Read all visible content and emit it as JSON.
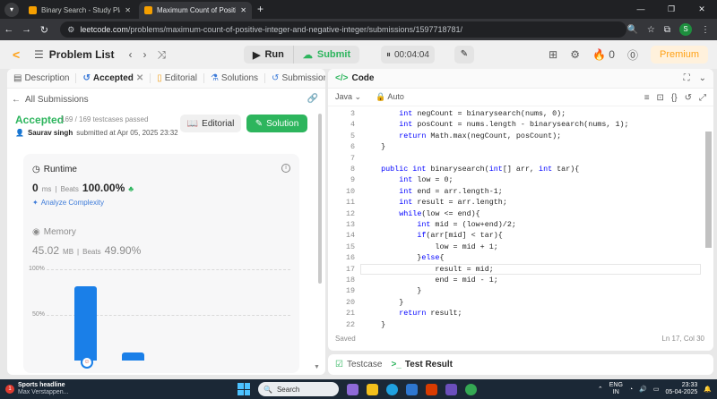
{
  "browser": {
    "tabs": [
      {
        "title": "Binary Search - Study Plan - Le"
      },
      {
        "title": "Maximum Count of Positive Inte"
      }
    ],
    "new_tab": "+",
    "url_host": "leetcode.com",
    "url_path": "/problems/maximum-count-of-positive-integer-and-negative-integer/submissions/1597718781/",
    "profile_initial": "S"
  },
  "topbar": {
    "problem_list": "Problem List",
    "run": "Run",
    "submit": "Submit",
    "timer": "00:04:04",
    "streak": "0",
    "premium": "Premium"
  },
  "left": {
    "tabs": [
      {
        "label": "Description",
        "icon": "description-icon"
      },
      {
        "label": "Accepted",
        "icon": "history-icon"
      },
      {
        "label": "Editorial",
        "icon": "book-icon"
      },
      {
        "label": "Solutions",
        "icon": "flask-icon"
      },
      {
        "label": "Submissions",
        "icon": "history-icon"
      }
    ],
    "all_submissions": "All Submissions",
    "status": "Accepted",
    "testcases": "169 / 169 testcases passed",
    "user": "Saurav singh",
    "submitted": "submitted at Apr 05, 2025 23:32",
    "editorial_btn": "Editorial",
    "solution_btn": "Solution",
    "runtime": {
      "label": "Runtime",
      "value": "0",
      "unit": "ms",
      "beats_label": "Beats",
      "beats": "100.00%",
      "analyze": "Analyze Complexity"
    },
    "memory": {
      "label": "Memory",
      "value": "45.02",
      "unit": "MB",
      "beats_label": "Beats",
      "beats": "49.90%"
    },
    "chart_data": {
      "type": "bar",
      "yticks": [
        "100%",
        "50%"
      ],
      "values": [
        0.81,
        0.09
      ]
    }
  },
  "code": {
    "title": "Code",
    "language": "Java",
    "auto": "Auto",
    "lines": [
      {
        "n": "3",
        "t": "        int negCount = binarysearch(nums, 0);"
      },
      {
        "n": "4",
        "t": "        int posCount = nums.length - binarysearch(nums, 1);"
      },
      {
        "n": "5",
        "t": "        return Math.max(negCount, posCount);"
      },
      {
        "n": "6",
        "t": "    }"
      },
      {
        "n": "7",
        "t": ""
      },
      {
        "n": "8",
        "t": "    public int binarysearch(int[] arr, int tar){"
      },
      {
        "n": "9",
        "t": "        int low = 0;"
      },
      {
        "n": "10",
        "t": "        int end = arr.length-1;"
      },
      {
        "n": "11",
        "t": "        int result = arr.length;"
      },
      {
        "n": "12",
        "t": "        while(low <= end){"
      },
      {
        "n": "13",
        "t": "            int mid = (low+end)/2;"
      },
      {
        "n": "14",
        "t": "            if(arr[mid] < tar){"
      },
      {
        "n": "15",
        "t": "                low = mid + 1;"
      },
      {
        "n": "16",
        "t": "            }else{"
      },
      {
        "n": "17",
        "t": "                result = mid;"
      },
      {
        "n": "18",
        "t": "                end = mid - 1;"
      },
      {
        "n": "19",
        "t": "            }"
      },
      {
        "n": "20",
        "t": "        }"
      },
      {
        "n": "21",
        "t": "        return result;"
      },
      {
        "n": "22",
        "t": "    }"
      }
    ],
    "status": "Saved",
    "position": "Ln 17, Col 30"
  },
  "bottom": {
    "testcase": "Testcase",
    "test_result": "Test Result"
  },
  "taskbar": {
    "news_title": "Sports headline",
    "news_sub": "Max Verstappen...",
    "search": "Search",
    "lang1": "ENG",
    "lang2": "IN",
    "time": "23:33",
    "date": "05-04-2025"
  },
  "colors": {
    "accent": "#ffa116",
    "success": "#2db55d",
    "bar": "#1a7fe8"
  }
}
